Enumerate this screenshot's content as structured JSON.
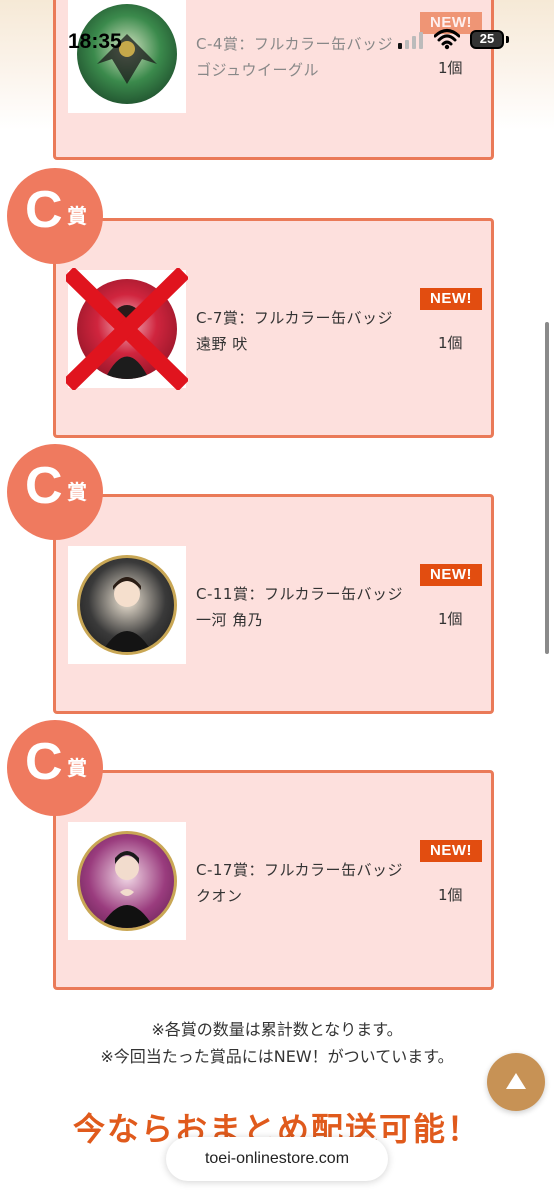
{
  "status_bar": {
    "time": "18:35",
    "battery": "25"
  },
  "prizes": [
    {
      "name": "C-4賞：フルカラー缶バッジ ゴジュウイーグル",
      "qty": "1個",
      "new_label": "NEW!",
      "grade": "C",
      "grade_kanji": "賞",
      "crossed_out": false
    },
    {
      "name": "C-7賞：フルカラー缶バッジ 遠野 吠",
      "qty": "1個",
      "new_label": "NEW!",
      "grade": "C",
      "grade_kanji": "賞",
      "crossed_out": true
    },
    {
      "name": "C-11賞：フルカラー缶バッジ 一河 角乃",
      "qty": "1個",
      "new_label": "NEW!",
      "grade": "C",
      "grade_kanji": "賞",
      "crossed_out": false
    },
    {
      "name": "C-17賞：フルカラー缶バッジ クオン",
      "qty": "1個",
      "new_label": "NEW!",
      "grade": "C",
      "grade_kanji": "賞",
      "crossed_out": false
    }
  ],
  "notes": {
    "line1": "※各賞の数量は累計数となります。",
    "line2": "※今回当たった賞品にはNEW！がついています。"
  },
  "promo": "今ならおまとめ配送可能！",
  "url": "toei-onlinestore.com",
  "colors": {
    "card_bg": "#fde0dd",
    "card_border": "#ea7a58",
    "grade_circle": "#ef7a5f",
    "new_tag": "#e24d10",
    "promo_text": "#e05a1c",
    "scroll_button": "#c79255"
  }
}
